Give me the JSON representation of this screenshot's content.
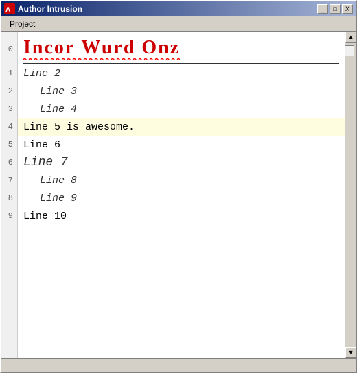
{
  "window": {
    "title": "Author Intrusion",
    "icon_label": "app-icon"
  },
  "menu": {
    "items": [
      {
        "label": "Project"
      }
    ]
  },
  "titlebar_buttons": {
    "minimize": "_",
    "maximize": "□",
    "close": "X"
  },
  "lines": [
    {
      "num": "0",
      "text": "Incor Wurd Onz",
      "type": "big-red-squiggly"
    },
    {
      "num": "1",
      "text": "Line 2",
      "type": "italic"
    },
    {
      "num": "2",
      "text": "Line 3",
      "type": "indented-italic"
    },
    {
      "num": "3",
      "text": "Line 4",
      "type": "indented-italic"
    },
    {
      "num": "4",
      "text": "Line 5 is awesome.",
      "type": "highlighted"
    },
    {
      "num": "5",
      "text": "Line 6",
      "type": "normal"
    },
    {
      "num": "6",
      "text": "Line 7",
      "type": "large-italic"
    },
    {
      "num": "7",
      "text": "Line 8",
      "type": "indented-italic"
    },
    {
      "num": "8",
      "text": "Line 9",
      "type": "indented-italic"
    },
    {
      "num": "9",
      "text": "Line 10",
      "type": "normal"
    }
  ]
}
